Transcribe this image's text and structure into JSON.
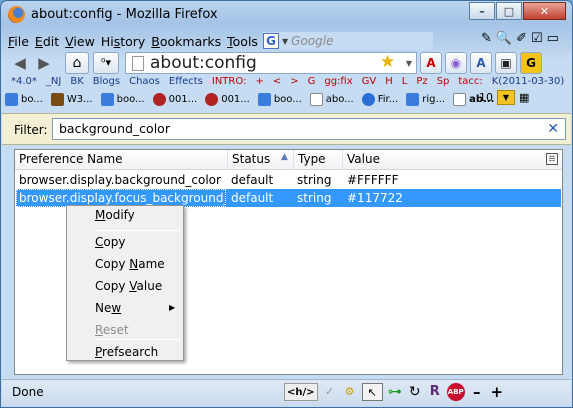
{
  "window": {
    "title": "about:config - Mozilla Firefox",
    "controls": {
      "minimize": "–",
      "maximize": "□",
      "close": "✕"
    }
  },
  "menu": {
    "items": [
      {
        "pre": "",
        "u": "F",
        "post": "ile"
      },
      {
        "pre": "",
        "u": "E",
        "post": "dit"
      },
      {
        "pre": "",
        "u": "V",
        "post": "iew"
      },
      {
        "pre": "Hi",
        "u": "s",
        "post": "tory"
      },
      {
        "pre": "",
        "u": "B",
        "post": "ookmarks"
      },
      {
        "pre": "",
        "u": "T",
        "post": "ools"
      },
      {
        "pre": "",
        "u": "H",
        "post": "elp"
      }
    ],
    "search_placeholder": "Google",
    "search_engine_glyph": "G"
  },
  "navigation": {
    "back": "◀",
    "forward": "▶",
    "home": "⌂",
    "url": "about:config",
    "bookmark_star": "★",
    "toolbar_glyphs": [
      "A",
      "◉",
      "A",
      "▣",
      "G"
    ]
  },
  "bookmarks_row1": [
    "*4.0*",
    "_NJ",
    "BK",
    "Blogs",
    "Chaos",
    "Effects",
    "INTRO:",
    "+",
    "<",
    ">",
    "G",
    "gg:fix",
    "GV",
    "H",
    "L",
    "Pz",
    "Sp",
    "tacc:",
    "K(2011-03-30)"
  ],
  "bookmarks_row2": [
    {
      "label": "bo...",
      "color": "#3b7ddd"
    },
    {
      "label": "W3...",
      "color": "#7b4b16"
    },
    {
      "label": "boo...",
      "color": "#3b7ddd"
    },
    {
      "label": "001...",
      "color": "#b22222"
    },
    {
      "label": "001...",
      "color": "#b22222"
    },
    {
      "label": "boo...",
      "color": "#3b7ddd"
    },
    {
      "label": "abo...",
      "color": "#ffffff"
    },
    {
      "label": "Fir...",
      "color": "#2b6fd6"
    },
    {
      "label": "rig...",
      "color": "#3b7ddd"
    },
    {
      "label": "ab...",
      "color": "#ffffff"
    }
  ],
  "tab_count": "10",
  "filter": {
    "label": "Filter:",
    "value": "background_color",
    "clear": "✕"
  },
  "table": {
    "columns": [
      "Preference Name",
      "Status",
      "Type",
      "Value"
    ],
    "rows": [
      {
        "name": "browser.display.background_color",
        "status": "default",
        "type": "string",
        "value": "#FFFFFF"
      },
      {
        "name": "browser.display.focus_background_c...",
        "status": "default",
        "type": "string",
        "value": "#117722"
      }
    ]
  },
  "context_menu": {
    "items": [
      {
        "pre": "",
        "u": "M",
        "post": "odify"
      },
      {
        "pre": "",
        "u": "C",
        "post": "opy"
      },
      {
        "pre": "Copy ",
        "u": "N",
        "post": "ame"
      },
      {
        "pre": "Copy ",
        "u": "V",
        "post": "alue"
      },
      {
        "pre": "Ne",
        "u": "w",
        "post": ""
      },
      {
        "pre": "",
        "u": "R",
        "post": "eset"
      },
      {
        "pre": "",
        "u": "P",
        "post": "refsearch"
      }
    ]
  },
  "status": {
    "text": "Done",
    "icons": [
      "<h/>",
      "✓",
      "⚙",
      "↖",
      "⊶",
      "↻",
      "R",
      "ABP",
      "–",
      "+"
    ]
  }
}
